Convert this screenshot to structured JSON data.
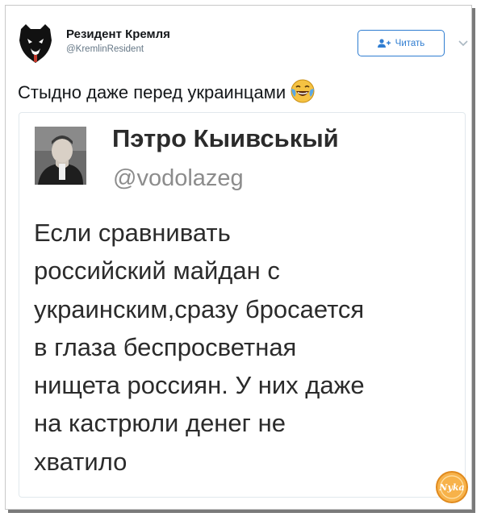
{
  "tweet": {
    "author_name": "Резидент Кремля",
    "author_handle": "@KremlinResident",
    "follow_label": "Читать",
    "text": "Стыдно даже перед украинцами",
    "emoji": "face-with-tears-of-joy"
  },
  "quoted": {
    "name": "Пэтро Кыивськый",
    "handle": "@vodolazeg",
    "lines": [
      "Если сравнивать",
      "российский майдан с",
      "украинским,сразу бросается",
      "в глаза беспросветная",
      "нищета россиян. У них даже",
      "на кастрюли денег не",
      "хватило"
    ]
  },
  "watermark": {
    "text": "Nyka"
  },
  "colors": {
    "accent": "#2f7dd1",
    "text": "#14171a",
    "muted": "#657786",
    "quote_text": "#2b2b2b",
    "handle_gray": "#8c8c8c",
    "watermark": "#f2a23a"
  }
}
